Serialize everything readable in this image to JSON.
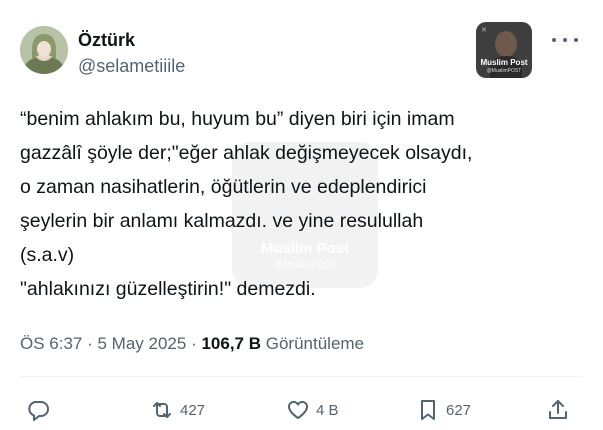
{
  "author": {
    "name": "Öztürk",
    "handle": "@selametiiile"
  },
  "badge": {
    "title": "Muslim Post",
    "subtitle": "@MuslimPOST"
  },
  "watermark": {
    "title": "Muslim Post",
    "subtitle": "@MuslimPOST"
  },
  "tweet": {
    "lines": [
      "“benim ahlakım bu, huyum bu” diyen biri için imam",
      "gazzâlî şöyle der;\"eğer ahlak değişmeyecek olsaydı,",
      "o zaman nasihatlerin, öğütlerin ve edeplendirici",
      "şeylerin bir anlamı kalmazdı. ve yine resulullah",
      "(s.a.v)",
      "\"ahlakınızı güzelleştirin!\" demezdi."
    ]
  },
  "meta": {
    "time": "ÖS 6:37",
    "date": "5 May 2025",
    "views_count": "106,7 B",
    "views_label": "Görüntüleme"
  },
  "actions": {
    "reply_count": "",
    "retweet_count": "427",
    "like_count": "4 B",
    "bookmark_count": "627"
  },
  "colors": {
    "text": "#0f1419",
    "secondary": "#536471",
    "divider": "#eff3f4"
  }
}
